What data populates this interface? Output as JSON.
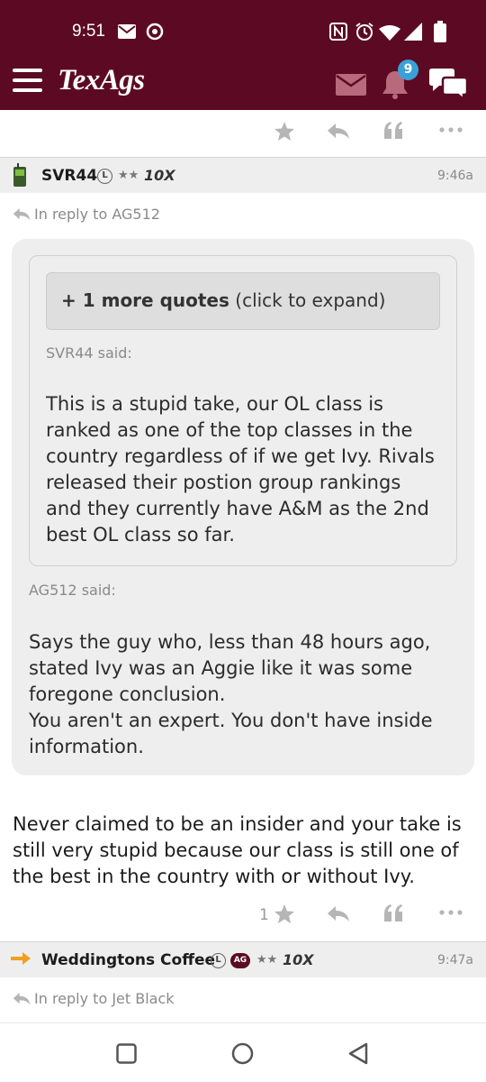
{
  "status_bar": {
    "time": "9:51"
  },
  "app_bar": {
    "brand": "TexAgs",
    "notification_count": "9"
  },
  "posts": [
    {
      "username": "SVR44",
      "level_badge": "L",
      "stars": "★★",
      "tenx": "10X",
      "time": "9:46a",
      "reply_to": "In reply to AG512",
      "more_quotes_bold": "+ 1 more quotes",
      "more_quotes_rest": " (click to expand)",
      "nested_author": "SVR44 said:",
      "nested_lines": [
        "This is a stupid take, our OL class is",
        "ranked as one of the top classes in the",
        "country regardless of if we get Ivy. Rivals",
        "released their postion group rankings",
        "and they currently have A&M as the 2nd",
        "best OL class so far."
      ],
      "quote_author": "AG512 said:",
      "quote_lines": [
        "Says the guy who, less than 48 hours ago,",
        "stated Ivy was an Aggie like it was some",
        "foregone conclusion.",
        "You aren't an expert. You don't have inside",
        "information."
      ],
      "body_lines": [
        "Never claimed to be an insider and your take is",
        "still very stupid because our class is still one of",
        "the best in the country with or without Ivy."
      ],
      "star_count": "1"
    },
    {
      "username": "Weddingtons Coffee",
      "level_badge": "L",
      "ag_badge": "AG",
      "stars": "★★",
      "tenx": "10X",
      "time": "9:47a",
      "reply_to": "In reply to Jet Black"
    }
  ],
  "colors": {
    "maroon": "#5c0a23",
    "badge_blue": "#3aa0d8",
    "icon_gray": "#b5b5b5"
  }
}
